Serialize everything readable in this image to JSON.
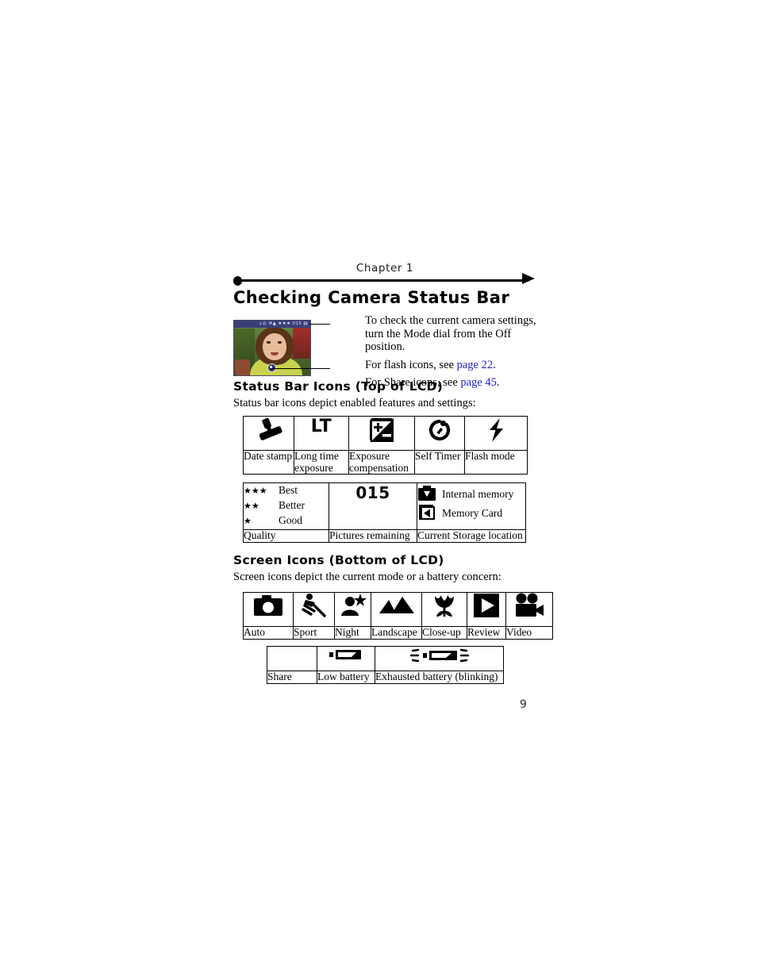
{
  "header": {
    "chapter_label": "Chapter 1"
  },
  "page_title": "Checking Camera Status Bar",
  "intro": {
    "paragraph1": "To check the current camera settings, turn the Mode dial from the Off position.",
    "flash_line_prefix": "For flash icons, see ",
    "flash_link": "page 22",
    "flash_line_suffix": ".",
    "share_line_prefix": "For Share icons, see ",
    "share_link": "page 45",
    "share_line_suffix": ".",
    "link_color": "#2222cc"
  },
  "lcd_preview": {
    "status_bar_text": "↓◎ ⑩▲ ★★★   015 ▤",
    "bottom_icon_name": "share-mode-icon",
    "caption": "camera-lcd-preview"
  },
  "sections": [
    {
      "heading": "Status Bar Icons (Top of LCD)",
      "intro": "Status bar icons depict enabled features and settings:"
    },
    {
      "heading": "Screen Icons (Bottom of LCD)",
      "intro": "Screen icons depict the current mode or a battery concern:"
    }
  ],
  "table_status_top": {
    "columns": [
      {
        "icon": "date-stamp-icon",
        "label": "Date stamp"
      },
      {
        "icon": "long-time-exposure-icon",
        "icon_text": "LT",
        "label": "Long time exposure"
      },
      {
        "icon": "exposure-compensation-icon",
        "label": "Exposure compensation"
      },
      {
        "icon": "self-timer-icon",
        "label": "Self Timer"
      },
      {
        "icon": "flash-mode-icon",
        "label": "Flash mode"
      }
    ]
  },
  "table_status_bottom": {
    "quality": {
      "rows": [
        {
          "stars": "★★★",
          "label": "Best"
        },
        {
          "stars": "★★",
          "label": "Better"
        },
        {
          "stars": "★",
          "label": "Good"
        }
      ],
      "footer": "Quality"
    },
    "pictures_remaining": {
      "value": "015",
      "footer": "Pictures remaining"
    },
    "storage": {
      "rows": [
        {
          "icon": "internal-memory-icon",
          "label": "Internal memory"
        },
        {
          "icon": "memory-card-icon",
          "label": "Memory Card"
        }
      ],
      "footer": "Current Storage location"
    }
  },
  "table_screen_modes": {
    "columns": [
      {
        "icon": "auto-camera-icon",
        "label": "Auto"
      },
      {
        "icon": "sport-icon",
        "label": "Sport"
      },
      {
        "icon": "night-icon",
        "label": "Night"
      },
      {
        "icon": "landscape-icon",
        "label": "Landscape"
      },
      {
        "icon": "close-up-tulip-icon",
        "label": "Close-up"
      },
      {
        "icon": "review-play-icon",
        "label": "Review"
      },
      {
        "icon": "video-camera-icon",
        "label": "Video"
      }
    ]
  },
  "table_battery": {
    "columns": [
      {
        "icon": "share-icon",
        "label": "Share"
      },
      {
        "icon": "low-battery-icon",
        "label": "Low battery"
      },
      {
        "icon": "exhausted-battery-icon",
        "label": "Exhausted battery (blinking)"
      }
    ]
  },
  "page_number": "9"
}
